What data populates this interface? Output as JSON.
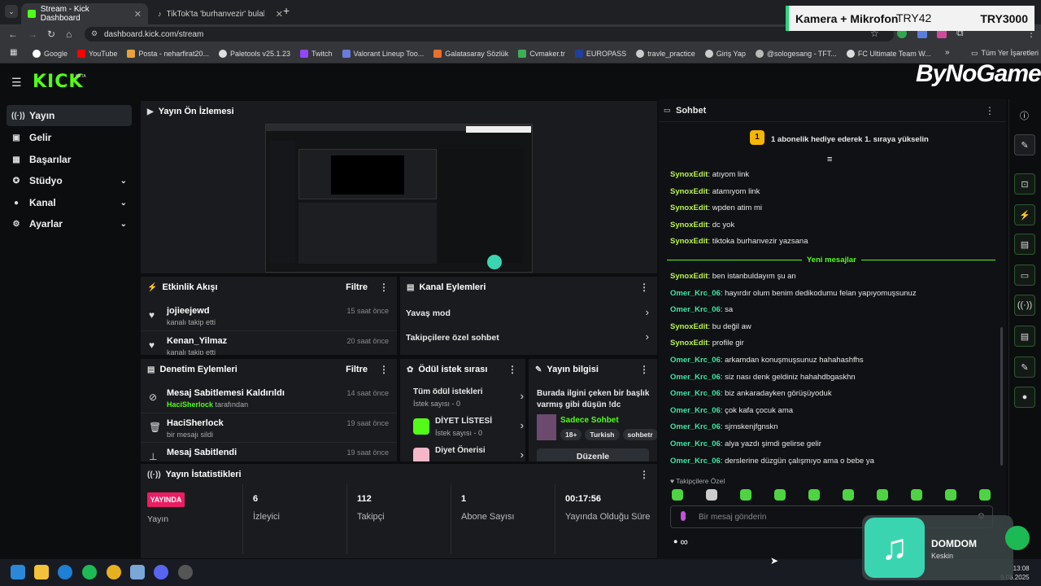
{
  "browser": {
    "tabs": [
      {
        "title": "Stream - Kick Dashboard",
        "active": true
      },
      {
        "title": "TikTok'ta 'burhanvezir' bulabilir...",
        "active": false
      }
    ],
    "new_tab": "+",
    "url": "dashboard.kick.com/stream",
    "bookmarks": [
      "Google",
      "YouTube",
      "Posta - neharfirat20...",
      "Paletools v25.1.23",
      "Twitch",
      "Valorant Lineup Too...",
      "Galatasaray Sözlük",
      "Cvmaker.tr",
      "EUROPASS",
      "travle_practice",
      "Giriş Yap",
      "@sologesang - TFT...",
      "FC Ultimate Team W..."
    ],
    "bookmarks_more": "»",
    "all_bookmarks": "Tüm Yer İşaretleri"
  },
  "overlay": {
    "left": "Kamera + Mikrofon",
    "mid": "TRY42",
    "right": "TRY3000"
  },
  "watermark": "ByNoGame",
  "kick": {
    "logo": "KICK",
    "beta": "BETA"
  },
  "sidebar": {
    "items": [
      {
        "label": "Yayın",
        "icon": "broadcast-icon"
      },
      {
        "label": "Gelir",
        "icon": "wallet-icon"
      },
      {
        "label": "Başarılar",
        "icon": "trophy-icon"
      },
      {
        "label": "Stüdyo",
        "icon": "studio-icon"
      },
      {
        "label": "Kanal",
        "icon": "person-icon"
      },
      {
        "label": "Ayarlar",
        "icon": "gear-icon"
      }
    ]
  },
  "preview": {
    "title": "Yayın Ön İzlemesi"
  },
  "activity": {
    "title": "Etkinlik Akışı",
    "filter": "Filtre",
    "events": [
      {
        "user": "jojieejewd",
        "action": "kanalı takip etti",
        "time": "15 saat önce"
      },
      {
        "user": "Kenan_Yilmaz",
        "action": "kanalı takip etti",
        "time": "20 saat önce"
      }
    ]
  },
  "channel_actions": {
    "title": "Kanal Eylemleri",
    "items": [
      "Yavaş mod",
      "Takipçilere özel sohbet"
    ]
  },
  "moderation": {
    "title": "Denetim Eylemleri",
    "filter": "Filtre",
    "events": [
      {
        "title": "Mesaj Sabitlemesi Kaldırıldı",
        "by_user": "HaciSherlock",
        "by_text": "tarafından",
        "time": "14 saat önce"
      },
      {
        "title": "HaciSherlock",
        "sub": "bir mesajı sildi",
        "time": "19 saat önce"
      },
      {
        "title": "Mesaj Sabitlendi",
        "time": "19 saat önce"
      }
    ]
  },
  "rewards": {
    "title": "Ödül istek sırası",
    "items": [
      {
        "name": "Tüm ödül istekleri",
        "sub": "İstek sayısı - 0"
      },
      {
        "name": "DİYET LİSTESİ",
        "sub": "İstek sayısı - 0"
      },
      {
        "name": "Diyet Önerisi",
        "sub": ""
      }
    ]
  },
  "stream_info": {
    "title": "Yayın bilgisi",
    "stream_title": "Burada ilgini çeken bir başlık varmış gibi düşün !dc",
    "category": "Sadece Sohbet",
    "tags": [
      "18+",
      "Turkish",
      "sohbetr"
    ],
    "edit": "Düzenle"
  },
  "stats": {
    "title": "Yayın İstatistikleri",
    "live_badge": "YAYINDA",
    "live_label": "Yayın",
    "items": [
      {
        "value": "6",
        "label": "İzleyici"
      },
      {
        "value": "112",
        "label": "Takipçi"
      },
      {
        "value": "1",
        "label": "Abone Sayısı"
      },
      {
        "value": "00:17:56",
        "label": "Yayında Olduğu Süre"
      }
    ]
  },
  "chat": {
    "title": "Sohbet",
    "gift_rank": "1",
    "gift_banner": "1 abonelik hediye ederek 1. sıraya yükselin",
    "new_messages": "Yeni mesajlar",
    "messages_before": [
      {
        "user": "SynoxEdit",
        "text": "atıyom link"
      },
      {
        "user": "SynoxEdit",
        "text": "atamıyom link"
      },
      {
        "user": "SynoxEdit",
        "text": "wpden atim mi"
      },
      {
        "user": "SynoxEdit",
        "text": "dc yok"
      },
      {
        "user": "SynoxEdit",
        "text": "tiktoka burhanvezir yazsana"
      }
    ],
    "messages_after": [
      {
        "user": "SynoxEdit",
        "text": "ben istanbuldayım şu an"
      },
      {
        "user": "Omer_Krc_06",
        "text": "hayırdır olum benim dedikodumu felan yapıyomuşsunuz"
      },
      {
        "user": "Omer_Krc_06",
        "text": "sa"
      },
      {
        "user": "SynoxEdit",
        "text": "bu değil aw"
      },
      {
        "user": "SynoxEdit",
        "text": "profile gir"
      },
      {
        "user": "Omer_Krc_06",
        "text": "arkamdan konuşmuşsunuz hahahashfhs"
      },
      {
        "user": "Omer_Krc_06",
        "text": "siz nası denk geldiniz hahahdbgaskhn"
      },
      {
        "user": "Omer_Krc_06",
        "text": "biz ankaradayken görüşüyoduk"
      },
      {
        "user": "Omer_Krc_06",
        "text": "çok kafa çocuk ama"
      },
      {
        "user": "Omer_Krc_06",
        "text": "sjrnskenjfgnskn"
      },
      {
        "user": "Omer_Krc_06",
        "text": "alya yazdı şimdi gelirse gelir"
      },
      {
        "user": "Omer_Krc_06",
        "text": "derslerine düzgün çalışmıyo ama o bebe ya"
      }
    ],
    "followers_only": "Takipçilere Özel",
    "input_placeholder": "Bir mesaj gönderin",
    "infinity": "∞"
  },
  "music": {
    "song": "DOMDOM",
    "artist": "Keskin"
  },
  "taskbar": {
    "time": "13:08",
    "date": "9.08.2025"
  },
  "colors": {
    "kick_green": "#53fc18",
    "live_red": "#e91e63",
    "panel": "#191b1f"
  }
}
